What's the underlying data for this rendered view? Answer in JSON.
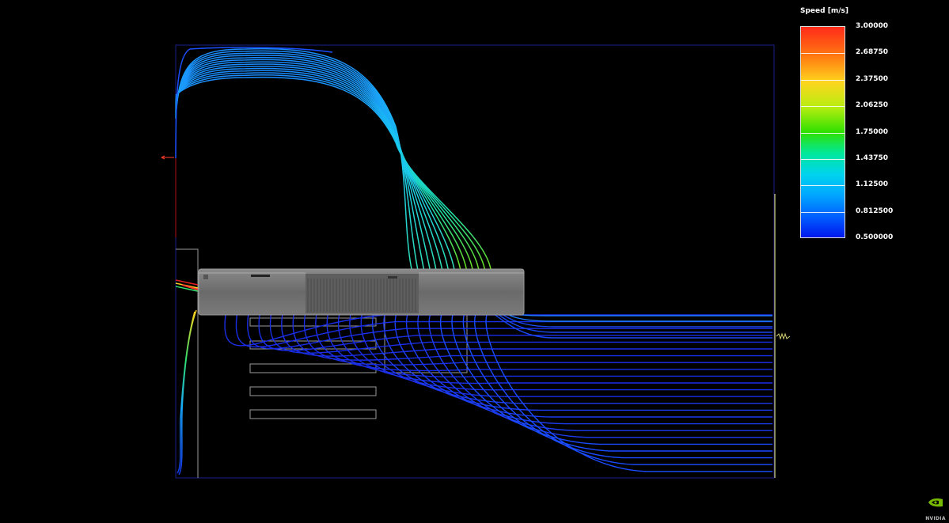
{
  "legend": {
    "title": "Speed [m/s]",
    "ticks": [
      "3.00000",
      "2.68750",
      "2.37500",
      "2.06250",
      "1.75000",
      "1.43750",
      "1.12500",
      "0.812500",
      "0.500000"
    ],
    "range": [
      0.5,
      3.0
    ],
    "colormap": [
      "#0018ee",
      "#0060ff",
      "#00a6ff",
      "#00d4ee",
      "#00e89a",
      "#2fe000",
      "#b8ee10",
      "#ffd41e",
      "#ff7a10",
      "#ff2a1a"
    ]
  },
  "logo": {
    "text": "NVIDIA"
  },
  "colors": {
    "background": "#000000",
    "domain_border": "#1a1f8a",
    "gpu_body": "#6e6e6e",
    "inlet_marker": "#d4d070",
    "outlet_marker": "#ff3a2a"
  }
}
